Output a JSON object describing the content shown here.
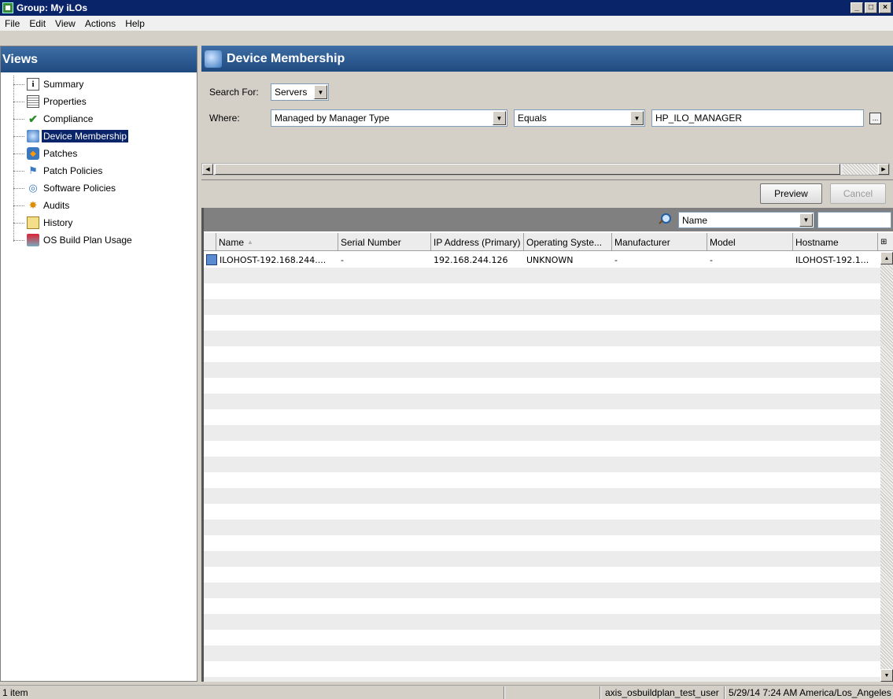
{
  "window": {
    "title": "Group: My iLOs"
  },
  "menu": [
    "File",
    "Edit",
    "View",
    "Actions",
    "Help"
  ],
  "views": {
    "title": "Views",
    "items": [
      {
        "label": "Summary",
        "icon": "summary-icon"
      },
      {
        "label": "Properties",
        "icon": "properties-icon"
      },
      {
        "label": "Compliance",
        "icon": "compliance-icon"
      },
      {
        "label": "Device Membership",
        "icon": "device-membership-icon",
        "selected": true
      },
      {
        "label": "Patches",
        "icon": "patches-icon"
      },
      {
        "label": "Patch Policies",
        "icon": "patch-policies-icon"
      },
      {
        "label": "Software Policies",
        "icon": "software-policies-icon"
      },
      {
        "label": "Audits",
        "icon": "audits-icon"
      },
      {
        "label": "History",
        "icon": "history-icon"
      },
      {
        "label": "OS Build Plan Usage",
        "icon": "os-build-plan-icon"
      }
    ]
  },
  "main": {
    "title": "Device Membership",
    "search": {
      "search_for_label": "Search For:",
      "search_for_value": "Servers",
      "where_label": "Where:",
      "where_value": "Managed by Manager Type",
      "operator_value": "Equals",
      "criteria_value": "HP_ILO_MANAGER",
      "ellipsis_label": "..."
    },
    "buttons": {
      "preview": "Preview",
      "cancel": "Cancel"
    },
    "filter": {
      "field_value": "Name",
      "text_value": ""
    },
    "table": {
      "columns": [
        "Name",
        "Serial Number",
        "IP Address (Primary)",
        "Operating Syste...",
        "Manufacturer",
        "Model",
        "Hostname"
      ],
      "sort_indicator": "▲",
      "rows": [
        [
          "ILOHOST-192.168.244....",
          "-",
          "192.168.244.126",
          "UNKNOWN",
          "-",
          "-",
          "ILOHOST-192.1..."
        ]
      ]
    }
  },
  "status": {
    "count": "1 item",
    "user": "axis_osbuildplan_test_user",
    "datetime": "5/29/14 7:24 AM America/Los_Angeles"
  }
}
